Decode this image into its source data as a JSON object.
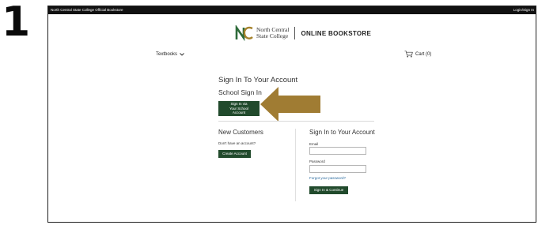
{
  "step": {
    "number": "1"
  },
  "topbar": {
    "site_name": "North Central State College Official Bookstore",
    "login_link": "Login/Sign In"
  },
  "logo": {
    "college_line1": "North Central",
    "college_line2": "State College",
    "store_label": "ONLINE BOOKSTORE"
  },
  "nav": {
    "textbooks": "Textbooks",
    "textbooks_icon": "chevron-down-icon",
    "cart": "Cart (0)",
    "cart_icon": "cart-icon"
  },
  "signin": {
    "title": "Sign In To Your Account",
    "school_heading": "School Sign In",
    "school_button_line1": "Sign In via",
    "school_button_line2": "Your School Account"
  },
  "new_customers": {
    "heading": "New Customers",
    "prompt": "Don't have an account?",
    "create_button": "Create Account"
  },
  "account": {
    "heading": "Sign In to Your Account",
    "email_label": "Email",
    "email_value": "",
    "password_label": "Password",
    "password_value": "",
    "forgot_link": "Forgot your password?",
    "continue_button": "Sign In & Continue"
  },
  "annotation": {
    "arrow_icon": "left-arrow-icon",
    "color": "#a07c33"
  },
  "colors": {
    "button": "#214a2c",
    "topbar": "#111111",
    "logo_green": "#2e6b3a",
    "logo_gold": "#a5822b"
  }
}
